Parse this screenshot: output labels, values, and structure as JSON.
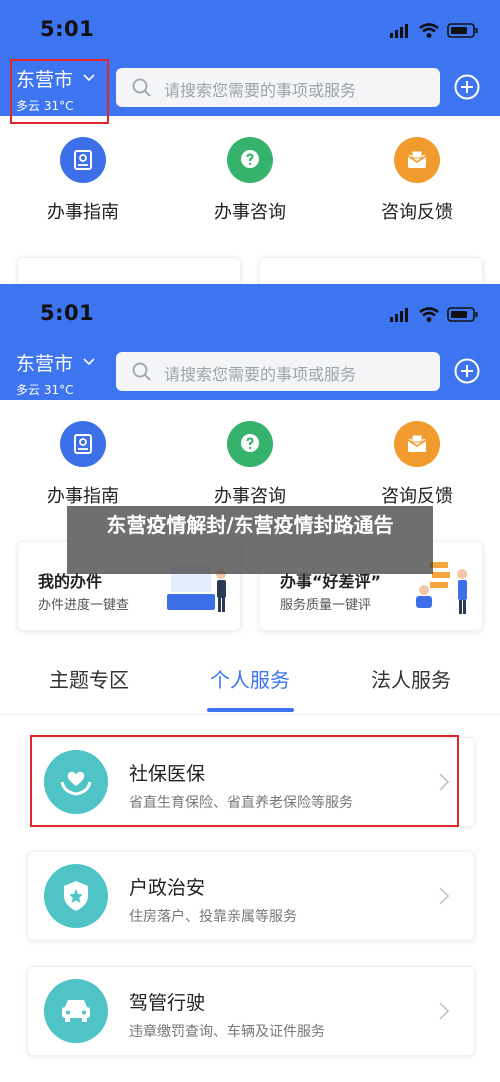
{
  "status_bar": {
    "time": "5:01"
  },
  "location": {
    "city": "东营市",
    "weather": "多云 31°C"
  },
  "search": {
    "placeholder": "请搜索您需要的事项或服务"
  },
  "quick_actions": [
    {
      "label": "办事指南",
      "icon": "guide-book-icon",
      "color": "#3d6fe8"
    },
    {
      "label": "办事咨询",
      "icon": "question-bubble-icon",
      "color": "#35b26b"
    },
    {
      "label": "咨询反馈",
      "icon": "feedback-envelope-icon",
      "color": "#f19a2d"
    }
  ],
  "cards": [
    {
      "title": "我的办件",
      "subtitle": "办件进度一键查"
    },
    {
      "title": "办事“好差评”",
      "subtitle": "服务质量一键评"
    }
  ],
  "tabs": [
    {
      "label": "主题专区",
      "active": false
    },
    {
      "label": "个人服务",
      "active": true
    },
    {
      "label": "法人服务",
      "active": false
    }
  ],
  "services": [
    {
      "title": "社保医保",
      "subtitle": "省直生育保险、省直养老保险等服务",
      "icon": "heart-hands-icon"
    },
    {
      "title": "户政治安",
      "subtitle": "住房落户、投靠亲属等服务",
      "icon": "police-shield-icon"
    },
    {
      "title": "驾管行驶",
      "subtitle": "违章缴罚查询、车辆及证件服务",
      "icon": "car-icon"
    }
  ],
  "overlay": {
    "title": "东营疫情解封/东营疫情封路通告"
  },
  "colors": {
    "brand_blue": "#3d74f0",
    "highlight_red": "#e0252c",
    "service_teal": "#4fc3c6"
  }
}
